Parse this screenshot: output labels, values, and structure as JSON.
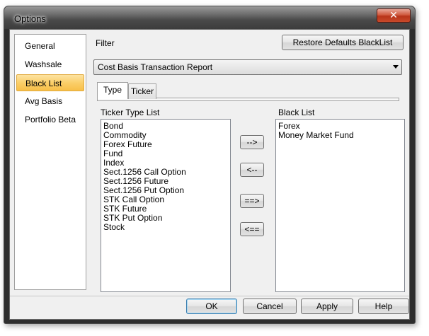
{
  "window": {
    "title": "Options",
    "close_glyph": "✕"
  },
  "nav": {
    "items": [
      {
        "label": "General",
        "active": false
      },
      {
        "label": "Washsale",
        "active": false
      },
      {
        "label": "Black List",
        "active": true
      },
      {
        "label": "Avg Basis",
        "active": false
      },
      {
        "label": "Portfolio Beta",
        "active": false
      }
    ]
  },
  "filter": {
    "label": "Filter",
    "restore_button": "Restore Defaults BlackList",
    "report_select": "Cost Basis Transaction Report"
  },
  "tabs": [
    {
      "label": "Type",
      "active": true
    },
    {
      "label": "Ticker",
      "active": false
    }
  ],
  "ticker_type_list": {
    "label": "Ticker Type List",
    "items": [
      "Bond",
      "Commodity",
      "Forex Future",
      "Fund",
      "Index",
      "Sect.1256 Call Option",
      "Sect.1256 Future",
      "Sect.1256 Put Option",
      "STK Call Option",
      "STK Future",
      "STK Put Option",
      "Stock"
    ]
  },
  "transfer": {
    "add": "-->",
    "remove": "<--",
    "add_all": "==>",
    "remove_all": "<=="
  },
  "black_list": {
    "label": "Black List",
    "items": [
      "Forex",
      "Money Market Fund"
    ]
  },
  "footer": {
    "ok": "OK",
    "cancel": "Cancel",
    "apply": "Apply",
    "help": "Help"
  },
  "colors": {
    "active_nav": "#fbcf6a",
    "close_button": "#c84a2a",
    "default_button_border": "#3c7fb1"
  }
}
